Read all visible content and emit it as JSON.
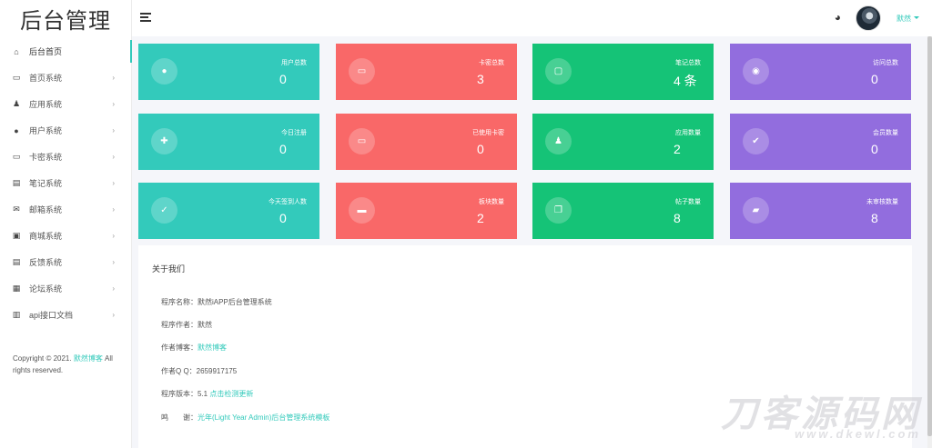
{
  "app": {
    "title": "后台管理"
  },
  "sidebar": {
    "items": [
      {
        "label": "后台首页",
        "icon": "home-icon",
        "glyph": "⌂",
        "arrow": ""
      },
      {
        "label": "首页系统",
        "icon": "monitor-icon",
        "glyph": "▭",
        "arrow": "›"
      },
      {
        "label": "应用系统",
        "icon": "android-icon",
        "glyph": "♟",
        "arrow": "›"
      },
      {
        "label": "用户系统",
        "icon": "user-icon",
        "glyph": "●",
        "arrow": "›"
      },
      {
        "label": "卡密系统",
        "icon": "card-icon",
        "glyph": "▭",
        "arrow": "›"
      },
      {
        "label": "笔记系统",
        "icon": "clipboard-icon",
        "glyph": "▤",
        "arrow": "›"
      },
      {
        "label": "邮箱系统",
        "icon": "mail-icon",
        "glyph": "✉",
        "arrow": "›"
      },
      {
        "label": "商城系统",
        "icon": "shopping-bag-icon",
        "glyph": "▣",
        "arrow": "›"
      },
      {
        "label": "反馈系统",
        "icon": "feedback-icon",
        "glyph": "▤",
        "arrow": "›"
      },
      {
        "label": "论坛系统",
        "icon": "grid-icon",
        "glyph": "▦",
        "arrow": "›"
      },
      {
        "label": "api接口文档",
        "icon": "docs-icon",
        "glyph": "▥",
        "arrow": "›"
      }
    ],
    "copyright_prefix": "Copyright © 2021. ",
    "copyright_link": "默然博客",
    "copyright_suffix": " All rights reserved."
  },
  "header": {
    "menu_icon": "hamburger-icon",
    "theme_icon": "palette-icon",
    "theme_glyph": "◕",
    "user_name": "默然"
  },
  "colors": {
    "teal": "#33cabb",
    "red": "#f96868",
    "green": "#15c377",
    "purple": "#926dde"
  },
  "stats": [
    {
      "label": "用户总数",
      "value": "0",
      "icon": "user-icon",
      "glyph": "●",
      "color": "teal"
    },
    {
      "label": "卡密总数",
      "value": "3",
      "icon": "card-icon",
      "glyph": "▭",
      "color": "red"
    },
    {
      "label": "笔记总数",
      "value": "4 条",
      "icon": "monitor-icon",
      "glyph": "▢",
      "color": "green"
    },
    {
      "label": "访问总数",
      "value": "0",
      "icon": "eye-icon",
      "glyph": "◉",
      "color": "purple"
    },
    {
      "label": "今日注册",
      "value": "0",
      "icon": "user-plus-icon",
      "glyph": "✚",
      "color": "teal"
    },
    {
      "label": "已使用卡密",
      "value": "0",
      "icon": "card-icon",
      "glyph": "▭",
      "color": "red"
    },
    {
      "label": "应用数量",
      "value": "2",
      "icon": "android-icon",
      "glyph": "♟",
      "color": "green"
    },
    {
      "label": "会员数量",
      "value": "0",
      "icon": "user-check-icon",
      "glyph": "✔",
      "color": "purple"
    },
    {
      "label": "今天签到人数",
      "value": "0",
      "icon": "check-circle-icon",
      "glyph": "✓",
      "color": "teal"
    },
    {
      "label": "板块数量",
      "value": "2",
      "icon": "folder-icon",
      "glyph": "▬",
      "color": "red"
    },
    {
      "label": "帖子数量",
      "value": "8",
      "icon": "copy-icon",
      "glyph": "❐",
      "color": "green"
    },
    {
      "label": "未审核数量",
      "value": "8",
      "icon": "folder-edit-icon",
      "glyph": "▰",
      "color": "purple"
    }
  ],
  "about": {
    "title": "关于我们",
    "rows": [
      {
        "key": "程序名称：",
        "value": "默然iAPP后台管理系统",
        "link": false
      },
      {
        "key": "程序作者：",
        "value": "默然",
        "link": false
      },
      {
        "key": "作者博客：",
        "value": "默然博客",
        "link": true
      },
      {
        "key": "作者Q Q：",
        "value": "2659917175",
        "link": false
      },
      {
        "key": "程序版本：",
        "value": "5.1 ",
        "link": false,
        "extra": "点击检测更新"
      },
      {
        "key": "鸣　　谢：",
        "value": "光年(Light Year Admin)后台管理系统模板",
        "link": true
      }
    ]
  },
  "watermark": {
    "big": "刀客源码网",
    "small": "www.dkewl.com"
  }
}
